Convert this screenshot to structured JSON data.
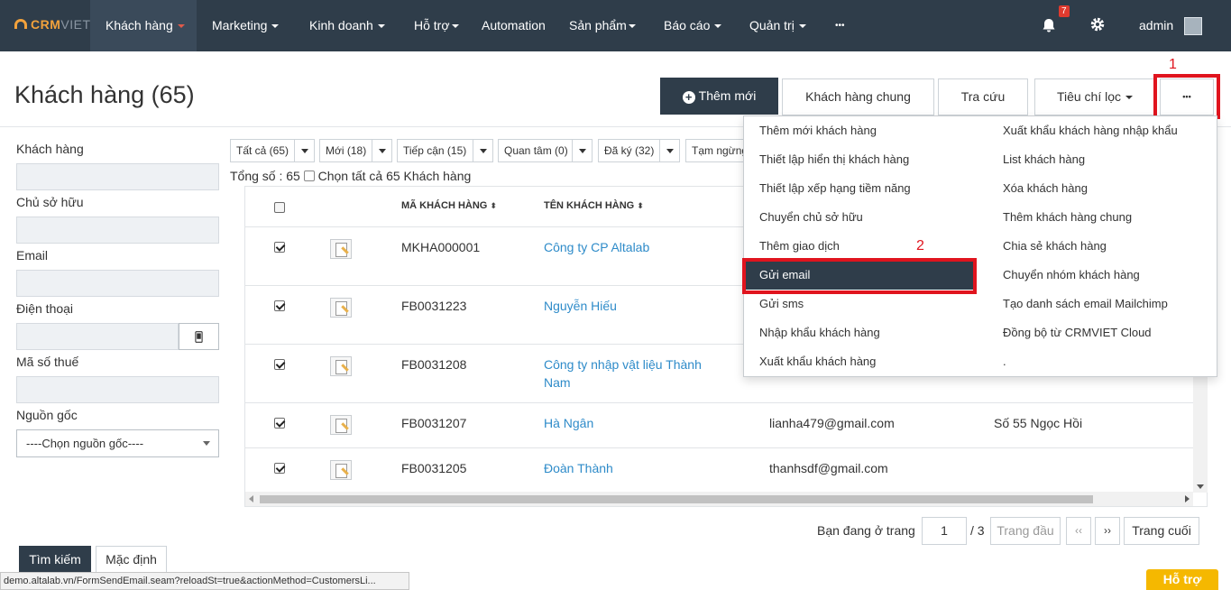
{
  "nav": {
    "logo_a": "CRM",
    "logo_b": "VIET",
    "items": [
      "Khách hàng",
      "Marketing",
      "Kinh doanh",
      "Hỗ trợ",
      "Automation",
      "Sản phẩm",
      "Báo cáo",
      "Quản trị",
      "•••"
    ],
    "notification_count": "7",
    "user": "admin"
  },
  "page": {
    "title": "Khách hàng (65)",
    "add_button": "Thêm mới",
    "common_button": "Khách hàng chung",
    "lookup_button": "Tra cứu",
    "criteria_button": "Tiêu chí lọc",
    "more_button": "•••",
    "step1": "1",
    "step2": "2"
  },
  "filters": {
    "customer_label": "Khách hàng",
    "owner_label": "Chủ sở hữu",
    "email_label": "Email",
    "phone_label": "Điện thoại",
    "tax_label": "Mã số thuế",
    "source_label": "Nguồn gốc",
    "source_value": "----Chọn nguồn gốc----",
    "search_button": "Tìm kiếm",
    "default_button": "Mặc định"
  },
  "tabs": [
    "Tất cả (65)",
    "Mới (18)",
    "Tiếp cận (15)",
    "Quan tâm (0)",
    "Đã ký (32)",
    "Tạm ngừng"
  ],
  "total": {
    "text": "Tổng số : 65",
    "select_all": "Chọn tất cả 65 Khách hàng"
  },
  "table": {
    "headers": [
      "MÃ KHÁCH HÀNG",
      "TÊN KHÁCH HÀNG"
    ],
    "rows": [
      {
        "code": "MKHA000001",
        "name": "Công ty CP Altalab",
        "name2": "",
        "email": "",
        "address": ""
      },
      {
        "code": "FB0031223",
        "name": "Nguyễn Hiếu",
        "name2": "",
        "email": "",
        "address": ""
      },
      {
        "code": "FB0031208",
        "name": "Công ty nhập vật liệu Thành",
        "name2": "Nam",
        "email": "",
        "address": ""
      },
      {
        "code": "FB0031207",
        "name": "Hà Ngân",
        "name2": "",
        "email": "lianha479@gmail.com",
        "address": "Số 55 Ngọc Hồi"
      },
      {
        "code": "FB0031205",
        "name": "Đoàn Thành",
        "name2": "",
        "email": "thanhsdf@gmail.com",
        "address": ""
      }
    ]
  },
  "pager": {
    "label": "Bạn đang ở trang",
    "page": "1",
    "of": "/ 3",
    "first": "Trang đầu",
    "prev": "‹‹",
    "next": "››",
    "last": "Trang cuối"
  },
  "menu": {
    "left": [
      "Thêm mới khách hàng",
      "Thiết lập hiển thị khách hàng",
      "Thiết lập xếp hạng tiềm năng",
      "Chuyển chủ sở hữu",
      "Thêm giao dịch",
      "Gửi email",
      "Gửi sms",
      "Nhập khẩu khách hàng",
      "Xuất khẩu khách hàng"
    ],
    "right": [
      "Xuất khẩu khách hàng nhập khẩu",
      "List khách hàng",
      "Xóa khách hàng",
      "Thêm khách hàng chung",
      "Chia sẻ khách hàng",
      "Chuyển nhóm khách hàng",
      "Tạo danh sách email Mailchimp",
      "Đồng bộ từ CRMVIET Cloud",
      "."
    ]
  },
  "statusbar": "demo.altalab.vn/FormSendEmail.seam?reloadSt=true&actionMethod=CustomersLi...",
  "help": "Hỗ trợ"
}
